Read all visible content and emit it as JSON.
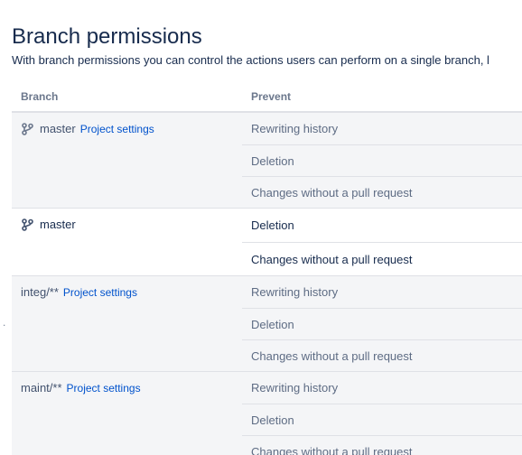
{
  "page": {
    "title": "Branch permissions",
    "description": "With branch permissions you can control the actions users can perform on a single branch, l",
    "stray_mark": "."
  },
  "table": {
    "headers": {
      "branch": "Branch",
      "prevent": "Prevent"
    },
    "groups": [
      {
        "branch": "master",
        "has_branch_icon": true,
        "link": "Project settings",
        "inherited": true,
        "prevent": [
          "Rewriting history",
          "Deletion",
          "Changes without a pull request"
        ]
      },
      {
        "branch": "master",
        "has_branch_icon": true,
        "link": "",
        "inherited": false,
        "prevent": [
          "Deletion",
          "Changes without a pull request"
        ]
      },
      {
        "branch": "integ/**",
        "has_branch_icon": false,
        "link": "Project settings",
        "inherited": true,
        "prevent": [
          "Rewriting history",
          "Deletion",
          "Changes without a pull request"
        ]
      },
      {
        "branch": "maint/**",
        "has_branch_icon": false,
        "link": "Project settings",
        "inherited": true,
        "prevent": [
          "Rewriting history",
          "Deletion",
          "Changes without a pull request"
        ]
      }
    ]
  },
  "colors": {
    "link": "#0052cc",
    "inherited_row_background": "#f4f5f7",
    "header_text": "#6b778c"
  },
  "icons": {
    "branch": "branch-icon"
  }
}
